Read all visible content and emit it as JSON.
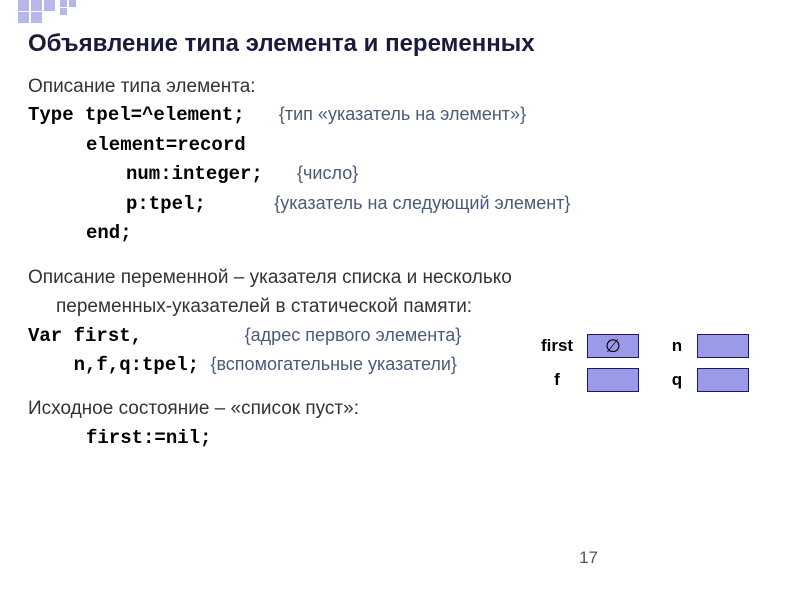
{
  "title": "Объявление типа элемента и переменных",
  "type_desc": "Описание типа элемента:",
  "type_kw": "Type ",
  "type_decl": "tpel=^element;",
  "type_comment": "{тип «указатель на элемент»}",
  "rec_decl": "element=record",
  "field1": "num:integer;",
  "field1_comment": "{число}",
  "field2": "p:tpel;",
  "field2_comment": "{указатель на следующий элемент}",
  "end_kw": "end;",
  "var_desc1": "Описание переменной – указателя  списка  и несколько",
  "var_desc2": "переменных-указателей в статической памяти:",
  "var_kw": "Var ",
  "var1": "first,",
  "var1_comment": "{адрес первого элемента}",
  "var2": "n,f,q:tpel;",
  "var2_comment": "{вспомогательные указатели}",
  "init_desc": "Исходное состояние – «список пуст»:",
  "init_code": "first:=nil;",
  "boxes": {
    "first": "first",
    "n": "n",
    "f": "f",
    "q": "q",
    "empty": "∅"
  },
  "page_num": "17"
}
